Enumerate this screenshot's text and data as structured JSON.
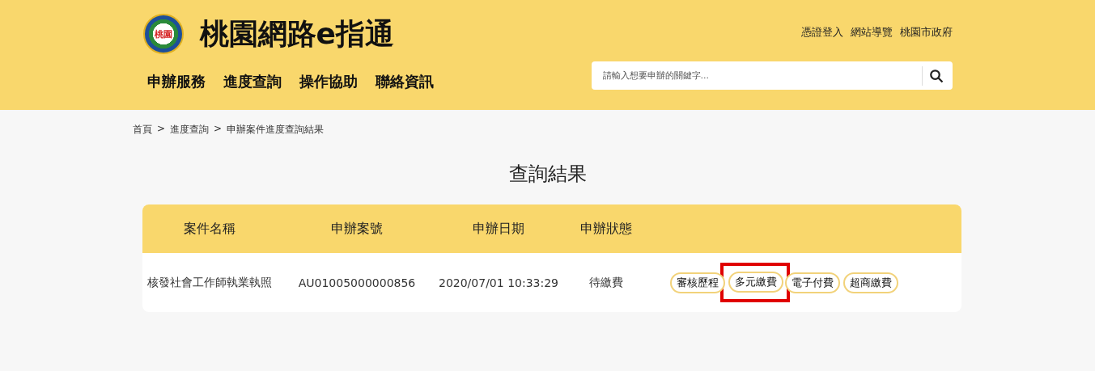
{
  "header": {
    "logo_text": "桃園",
    "site_title": "桃園網路e指通",
    "top_links": [
      "憑證登入",
      "網站導覽",
      "桃園市政府"
    ],
    "nav": [
      "申辦服務",
      "進度查詢",
      "操作協助",
      "聯絡資訊"
    ],
    "search": {
      "placeholder": "請輸入想要申辦的關鍵字..."
    }
  },
  "breadcrumb": {
    "separator": ">",
    "items": [
      "首頁",
      "進度查詢",
      "申辦案件進度查詢結果"
    ]
  },
  "page_title": "查詢結果",
  "table": {
    "columns": [
      "案件名稱",
      "申辦案號",
      "申辦日期",
      "申辦狀態"
    ],
    "rows": [
      {
        "cells": [
          "核發社會工作師執業執照",
          "AU01005000000856",
          "2020/07/01 10:33:29",
          "待繳費"
        ],
        "actions": [
          {
            "label": "審核歷程",
            "highlighted": false
          },
          {
            "label": "多元繳費",
            "highlighted": true
          },
          {
            "label": "電子付費",
            "highlighted": false
          },
          {
            "label": "超商繳費",
            "highlighted": false
          }
        ]
      }
    ]
  }
}
